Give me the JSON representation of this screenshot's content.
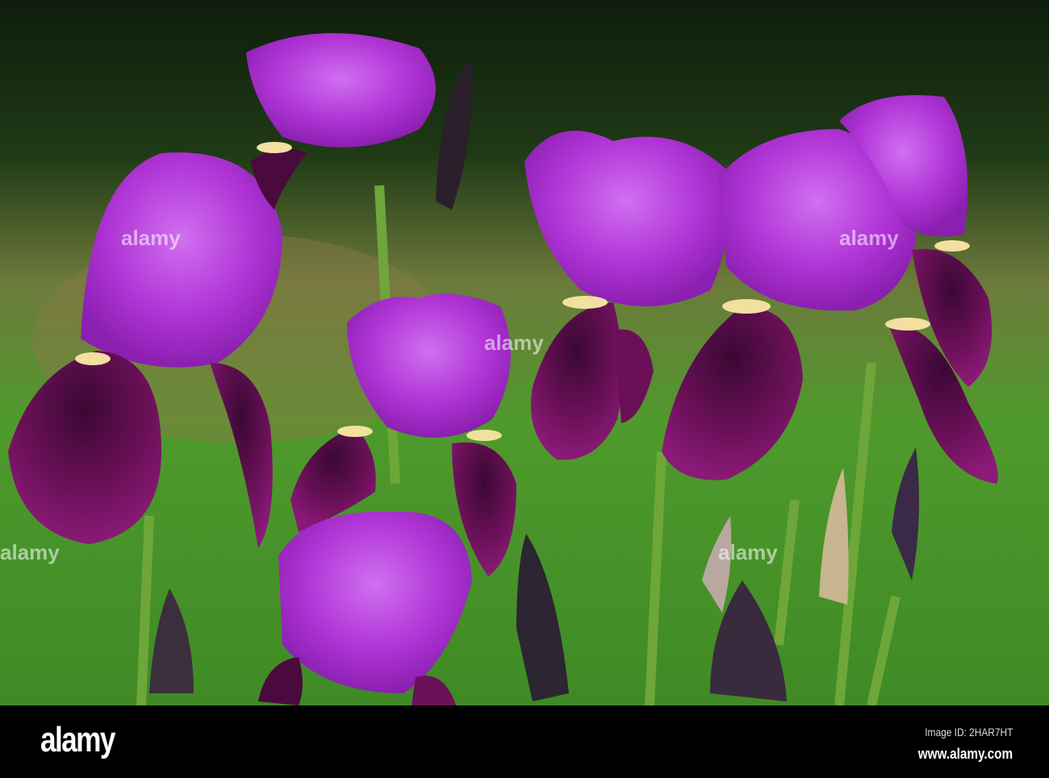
{
  "watermark": {
    "brand": "alamy",
    "image_id": "Image ID: 2HAR7HT",
    "site": "www.alamy.com"
  },
  "colors": {
    "background_dark": "#12240f",
    "grass": "#4a9a2a",
    "petal_light": "#b536d8",
    "petal_dark": "#4a0a3e",
    "stem": "#6ea63a"
  }
}
